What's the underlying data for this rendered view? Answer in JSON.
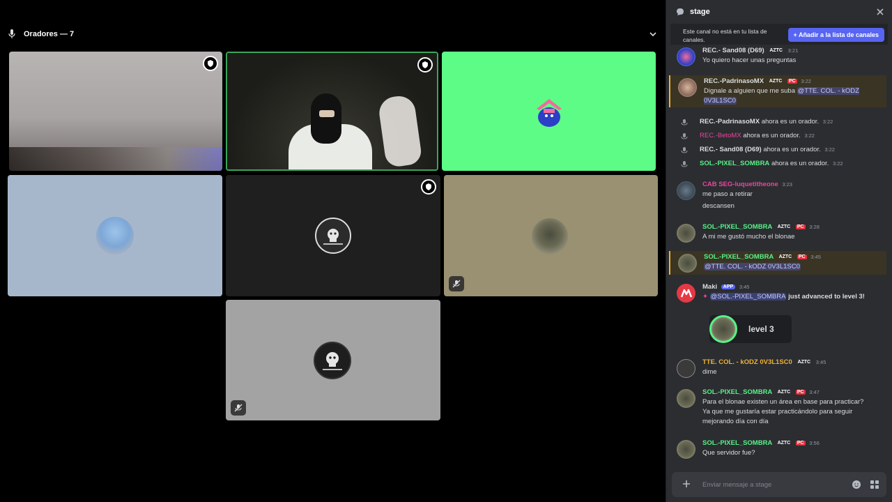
{
  "stage": {
    "header_title": "Oradores — 7"
  },
  "chat": {
    "channel_name": "stage",
    "notice_text": "Este canal no está en tu lista de canales.",
    "add_button_label": "+ Añadir a la lista de canales",
    "composer_placeholder": "Enviar mensaje a stage",
    "messages": [
      {
        "author": "REC.- Sand08 (D69)",
        "author_color": "#dbdee1",
        "tag": "AZTC",
        "time": "3:21",
        "text": "Yo quiero hacer unas preguntas"
      },
      {
        "author": "REC.-PadrinasoMX",
        "author_color": "#dbdee1",
        "tag": "AZTC",
        "pc": "PC",
        "time": "3:22",
        "text": "Dignale a alguien que me suba",
        "mention": "@TTE. COL. - kODZ 0V3L1SC0"
      },
      {
        "author": "CAB SEG-luquetitheone",
        "author_color": "#eb459e",
        "time": "3:23",
        "lines": [
          "me paso a retirar",
          "descansen"
        ]
      },
      {
        "author": "SOL.-PIXEL_SOMBRA",
        "author_color": "#57f287",
        "tag": "AZTC",
        "pc": "PC",
        "time": "3:28",
        "text": "A mi me gustó mucho el blonae"
      },
      {
        "author": "SOL.-PIXEL_SOMBRA",
        "author_color": "#57f287",
        "tag": "AZTC",
        "pc": "PC",
        "time": "3:45",
        "mention": "@TTE. COL. - kODZ 0V3L1SC0"
      },
      {
        "author": "Maki",
        "author_color": "#dbdee1",
        "app": "APP",
        "time": "3:45",
        "mention": "@SOL.-PIXEL_SOMBRA",
        "text": "just advanced to level 3!",
        "level_label": "level 3"
      },
      {
        "author": "TTE. COL. - kODZ 0V3L1SC0",
        "author_color": "#f0b232",
        "tag": "AZTC",
        "time": "3:45",
        "text": "dime"
      },
      {
        "author": "SOL.-PIXEL_SOMBRA",
        "author_color": "#57f287",
        "tag": "AZTC",
        "pc": "PC",
        "time": "3:47",
        "text": "Para el blonae existen un área en base para practicar? Ya que me gustaría estar practicándolo para seguir mejorando día con día"
      },
      {
        "author": "SOL.-PIXEL_SOMBRA",
        "author_color": "#57f287",
        "tag": "AZTC",
        "pc": "PC",
        "time": "3:56",
        "text": "Que servidor fue?"
      }
    ],
    "system_events": [
      {
        "name": "REC.-PadrinasoMX",
        "name_color": "#dbdee1",
        "suffix": "ahora es un orador.",
        "time": "3:22"
      },
      {
        "name": "REC.-BetoMX",
        "name_color": "#eb459e",
        "suffix": "ahora es un orador.",
        "time": "3:22"
      },
      {
        "name": "REC.- Sand08 (D69)",
        "name_color": "#dbdee1",
        "suffix": "ahora es un orador.",
        "time": "3:22"
      },
      {
        "name": "SOL.-PIXEL_SOMBRA",
        "name_color": "#57f287",
        "suffix": "ahora es un orador.",
        "time": "3:22"
      }
    ]
  },
  "colors": {
    "accent": "#5865f2",
    "green_tile": "#5dfc86",
    "blue_tile": "#a6b7cc",
    "khaki_tile": "#9a9072",
    "gray_tile": "#a3a3a3",
    "dark_tile": "#1f1f1f",
    "speaking_border": "#3ba55c"
  }
}
